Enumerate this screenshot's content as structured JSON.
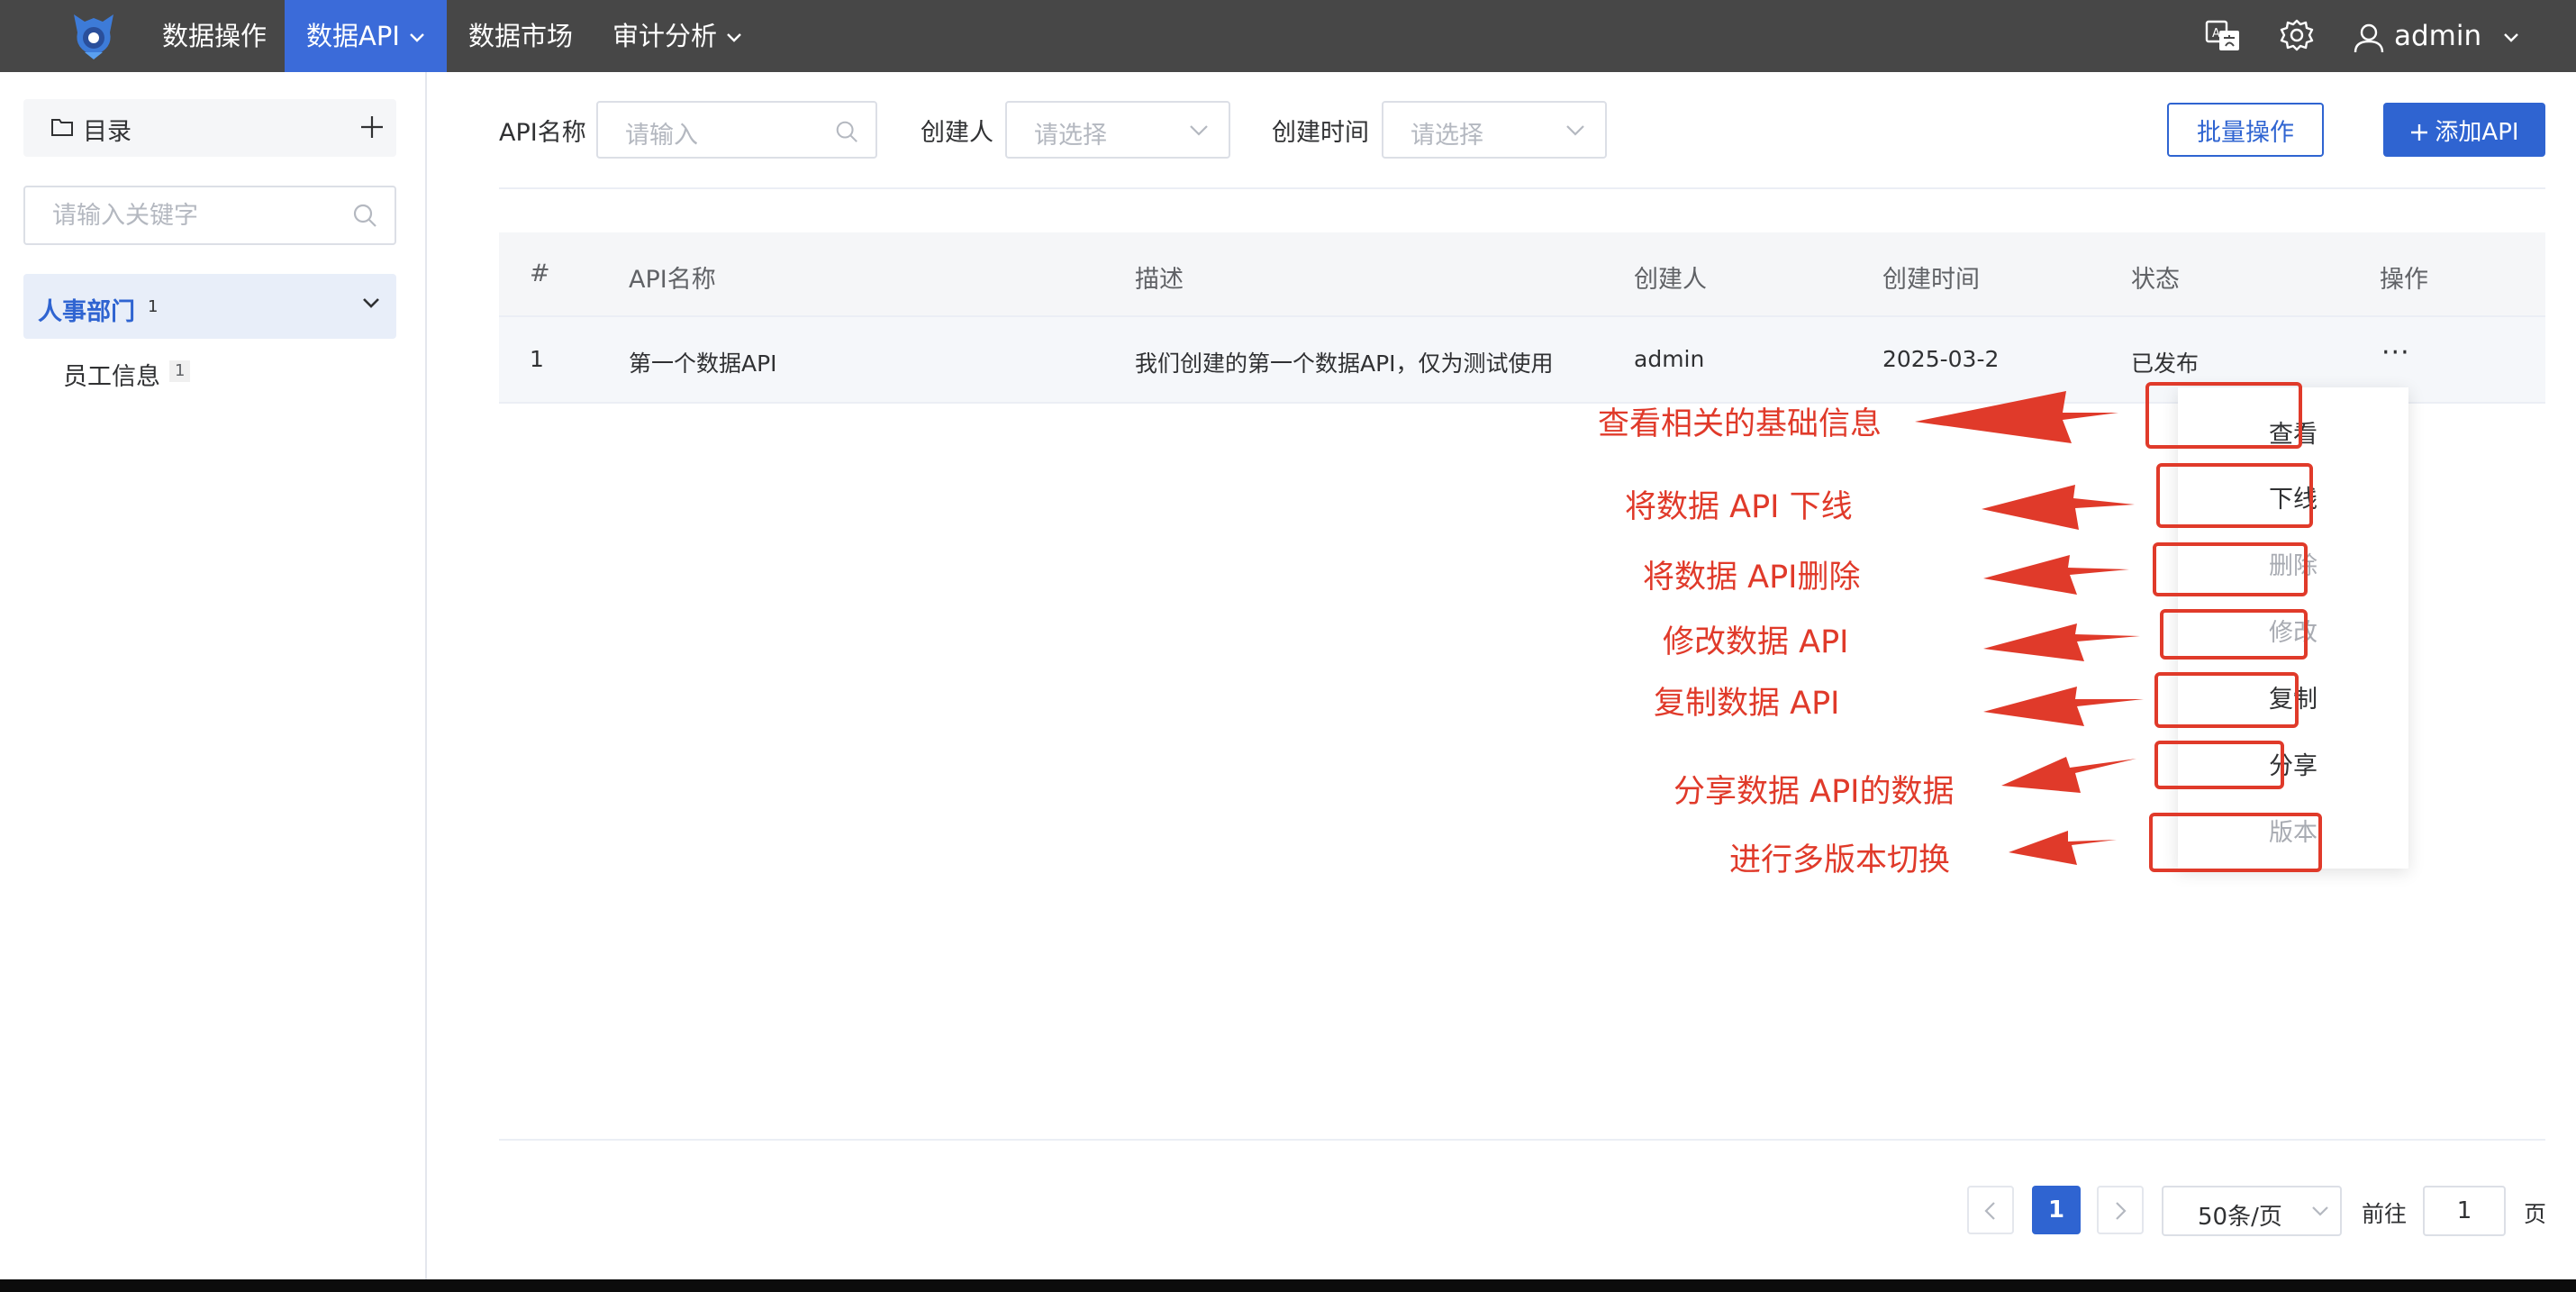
{
  "topnav": {
    "menu": [
      "数据操作",
      "数据API",
      "数据市场",
      "审计分析"
    ],
    "active_index": 1,
    "user": "admin",
    "icons": [
      "translate-icon",
      "settings-gear-icon",
      "user-icon"
    ]
  },
  "sidebar": {
    "title": "目录",
    "search_placeholder": "请输入关键字",
    "tree": [
      {
        "label": "人事部门",
        "count": "1",
        "expanded": true
      },
      {
        "label": "员工信息",
        "count": "1"
      }
    ]
  },
  "filters": {
    "api_name": {
      "label": "API名称",
      "placeholder": "请输入"
    },
    "creator": {
      "label": "创建人",
      "placeholder": "请选择"
    },
    "created_time": {
      "label": "创建时间",
      "placeholder": "请选择"
    },
    "batch_button": "批量操作",
    "add_button": "添加API"
  },
  "table": {
    "columns": [
      "#",
      "API名称",
      "描述",
      "创建人",
      "创建时间",
      "状态",
      "操作"
    ],
    "rows": [
      {
        "index": "1",
        "name": "第一个数据API",
        "desc": "我们创建的第一个数据API，仅为测试使用",
        "creator": "admin",
        "created": "2025-03-2",
        "status": "已发布",
        "action": "···"
      }
    ]
  },
  "menu": {
    "items": [
      {
        "label": "查看",
        "enabled": true
      },
      {
        "label": "下线",
        "enabled": true
      },
      {
        "label": "删除",
        "enabled": false
      },
      {
        "label": "修改",
        "enabled": false
      },
      {
        "label": "复制",
        "enabled": true
      },
      {
        "label": "分享",
        "enabled": true
      },
      {
        "label": "版本",
        "enabled": false
      }
    ]
  },
  "annotations": [
    "查看相关的基础信息",
    "将数据 API 下线",
    "将数据 API删除",
    "修改数据 API",
    "复制数据 API",
    "分享数据 API的数据",
    "进行多版本切换"
  ],
  "pagination": {
    "current": "1",
    "page_size": "50条/页",
    "goto_label": "前往",
    "goto_value": "1",
    "page_suffix": "页"
  },
  "colors": {
    "nav_bg": "#474747",
    "primary": "#2f64d1",
    "annotation_red": "#e03a2a"
  }
}
